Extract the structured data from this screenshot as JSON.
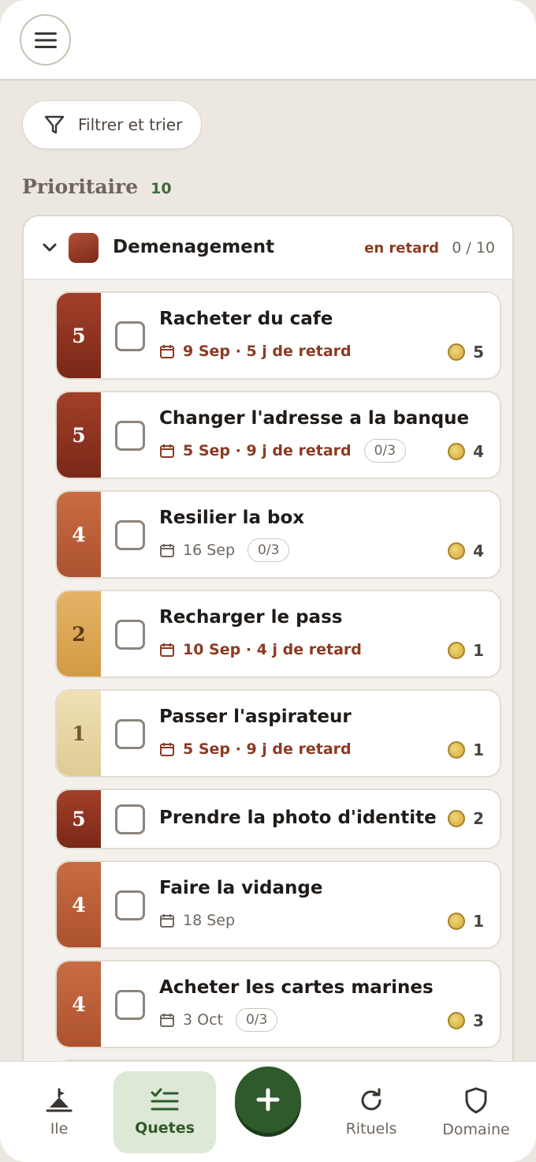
{
  "toolbar": {
    "filter_label": "Filtrer et trier"
  },
  "section": {
    "title": "Prioritaire",
    "count": "10"
  },
  "group": {
    "name": "Demenagement",
    "status": "en retard",
    "progress": "0 / 10",
    "color": "#9a3b26"
  },
  "tasks": [
    {
      "priority": "5",
      "title": "Racheter du cafe",
      "meta": "9 Sep · 5 j de retard",
      "overdue": true,
      "sub": "",
      "reward": "5"
    },
    {
      "priority": "5",
      "title": "Changer l'adresse a la banque",
      "meta": "5 Sep · 9 j de retard",
      "overdue": true,
      "sub": "0/3",
      "reward": "4"
    },
    {
      "priority": "4",
      "title": "Resilier la box",
      "meta": "16 Sep",
      "overdue": false,
      "sub": "0/3",
      "reward": "4"
    },
    {
      "priority": "2",
      "title": "Recharger le pass",
      "meta": "10 Sep · 4 j de retard",
      "overdue": true,
      "sub": "",
      "reward": "1"
    },
    {
      "priority": "1",
      "title": "Passer l'aspirateur",
      "meta": "5 Sep · 9 j de retard",
      "overdue": true,
      "sub": "",
      "reward": "1"
    },
    {
      "priority": "5",
      "title": "Prendre la photo d'identite",
      "meta": "",
      "overdue": false,
      "sub": "",
      "reward": "2"
    },
    {
      "priority": "4",
      "title": "Faire la vidange",
      "meta": "18 Sep",
      "overdue": false,
      "sub": "",
      "reward": "1"
    },
    {
      "priority": "4",
      "title": "Acheter les cartes marines",
      "meta": "3 Oct",
      "overdue": false,
      "sub": "0/3",
      "reward": "3"
    }
  ],
  "nav": {
    "ile": "Ile",
    "quetes": "Quetes",
    "rituels": "Rituels",
    "domaine": "Domaine",
    "active": "Quetes"
  },
  "icons": {
    "menu": "hamburger-icon",
    "filter": "funnel-icon",
    "calendar": "calendar-icon",
    "coin": "coin-icon",
    "add": "plus-icon"
  }
}
